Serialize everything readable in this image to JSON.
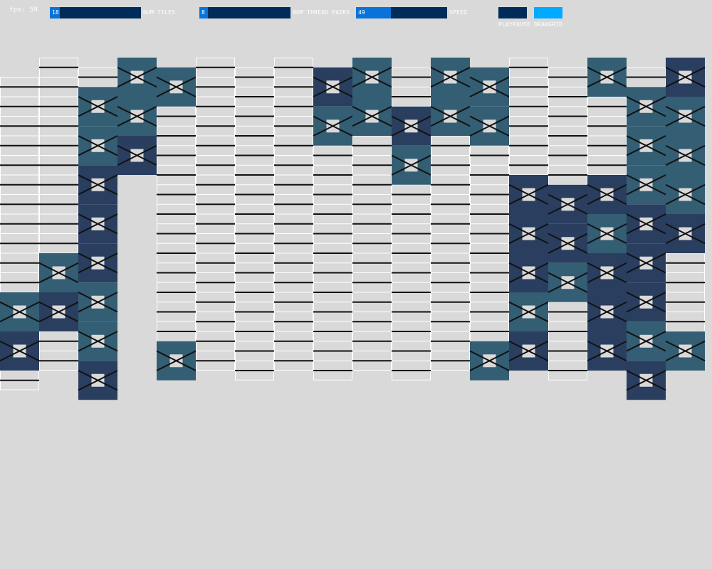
{
  "fps": "fps: 59",
  "controls": {
    "num_tiles": {
      "label": "NUM TILES",
      "value": "18",
      "fraction": 0.11
    },
    "num_thread_pairs": {
      "label": "NUM THREAD PAIRS",
      "value": "8",
      "fraction": 0.09
    },
    "speed": {
      "label": "SPEED",
      "value": "49",
      "fraction": 0.38
    },
    "playpause": {
      "label": "PLAYPAUSE",
      "active": false
    },
    "drawgrid": {
      "label": "DRAWGRID",
      "active": true
    }
  },
  "colors": {
    "background": "#d9d9d9",
    "slider_bg": "#002c5b",
    "slider_fill": "#0a73d9",
    "toggle_off": "#002c5b",
    "toggle_on": "#00aaff",
    "tile_dark": "#2a3e60",
    "tile_teal": "#335e73",
    "thread": "#111111",
    "grid": "#ffffff",
    "center": "#d9d9d9"
  },
  "weave": {
    "columns": [
      {
        "offset": 2,
        "rows": 16,
        "crossings": [
          [
            11,
            "teal"
          ],
          [
            13,
            "dark"
          ]
        ]
      },
      {
        "offset": 0,
        "rows": 16,
        "crossings": [
          [
            10,
            "teal"
          ],
          [
            12,
            "dark"
          ]
        ]
      },
      {
        "offset": 1,
        "rows": 16,
        "crossings": [
          [
            1,
            "teal"
          ],
          [
            3,
            "teal"
          ],
          [
            5,
            "dark"
          ],
          [
            7,
            "dark"
          ],
          [
            9,
            "dark"
          ],
          [
            11,
            "teal"
          ],
          [
            13,
            "teal"
          ],
          [
            15,
            "dark"
          ]
        ]
      },
      {
        "offset": 0,
        "rows": 6,
        "crossings": [
          [
            0,
            "teal"
          ],
          [
            2,
            "teal"
          ],
          [
            4,
            "dark"
          ]
        ]
      },
      {
        "offset": 1,
        "rows": 16,
        "crossings": [
          [
            0,
            "teal"
          ],
          [
            14,
            "teal"
          ]
        ]
      },
      {
        "offset": 0,
        "rows": 16,
        "crossings": []
      },
      {
        "offset": 1,
        "rows": 16,
        "crossings": []
      },
      {
        "offset": 0,
        "rows": 16,
        "crossings": []
      },
      {
        "offset": 1,
        "rows": 16,
        "crossings": [
          [
            0,
            "dark"
          ],
          [
            2,
            "teal"
          ]
        ]
      },
      {
        "offset": 0,
        "rows": 16,
        "crossings": [
          [
            0,
            "teal"
          ],
          [
            2,
            "teal"
          ]
        ]
      },
      {
        "offset": 1,
        "rows": 16,
        "crossings": [
          [
            2,
            "dark"
          ],
          [
            4,
            "teal"
          ]
        ]
      },
      {
        "offset": 0,
        "rows": 16,
        "crossings": [
          [
            0,
            "teal"
          ],
          [
            2,
            "teal"
          ]
        ]
      },
      {
        "offset": 1,
        "rows": 16,
        "crossings": [
          [
            0,
            "teal"
          ],
          [
            2,
            "teal"
          ],
          [
            14,
            "teal"
          ]
        ]
      },
      {
        "offset": 0,
        "rows": 16,
        "crossings": [
          [
            6,
            "dark"
          ],
          [
            8,
            "dark"
          ],
          [
            10,
            "dark"
          ],
          [
            12,
            "teal"
          ],
          [
            14,
            "dark"
          ]
        ]
      },
      {
        "offset": 1,
        "rows": 16,
        "crossings": [
          [
            6,
            "dark"
          ],
          [
            8,
            "dark"
          ],
          [
            10,
            "teal"
          ]
        ]
      },
      {
        "offset": 0,
        "rows": 16,
        "crossings": [
          [
            0,
            "teal"
          ],
          [
            6,
            "dark"
          ],
          [
            8,
            "teal"
          ],
          [
            10,
            "dark"
          ],
          [
            12,
            "dark"
          ],
          [
            14,
            "dark"
          ]
        ]
      },
      {
        "offset": 1,
        "rows": 16,
        "crossings": [
          [
            1,
            "teal"
          ],
          [
            3,
            "teal"
          ],
          [
            5,
            "teal"
          ],
          [
            7,
            "dark"
          ],
          [
            9,
            "dark"
          ],
          [
            11,
            "dark"
          ],
          [
            13,
            "teal"
          ],
          [
            15,
            "dark"
          ]
        ]
      },
      {
        "offset": 0,
        "rows": 16,
        "crossings": [
          [
            0,
            "dark"
          ],
          [
            2,
            "teal"
          ],
          [
            4,
            "teal"
          ],
          [
            6,
            "teal"
          ],
          [
            8,
            "dark"
          ],
          [
            14,
            "teal"
          ]
        ]
      }
    ]
  }
}
